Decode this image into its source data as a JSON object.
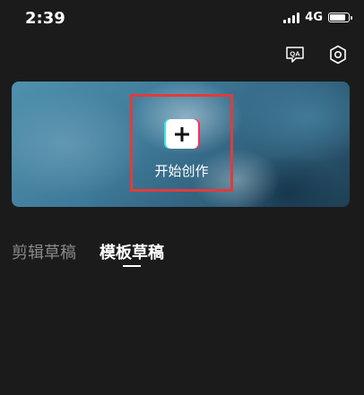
{
  "status_bar": {
    "time": "2:39",
    "network": "4G"
  },
  "header": {
    "icons": [
      "qa-icon",
      "settings-icon"
    ],
    "qa_text": "QA"
  },
  "banner": {
    "create_label": "开始创作"
  },
  "tabs": [
    {
      "label": "剪辑草稿",
      "active": false
    },
    {
      "label": "模板草稿",
      "active": true
    }
  ],
  "colors": {
    "background": "#1b1b1b",
    "highlight_border": "#e23b3b",
    "inactive_tab": "#8a8a8a",
    "accent_cyan": "#2ee6e6",
    "accent_red": "#ff2d55"
  }
}
